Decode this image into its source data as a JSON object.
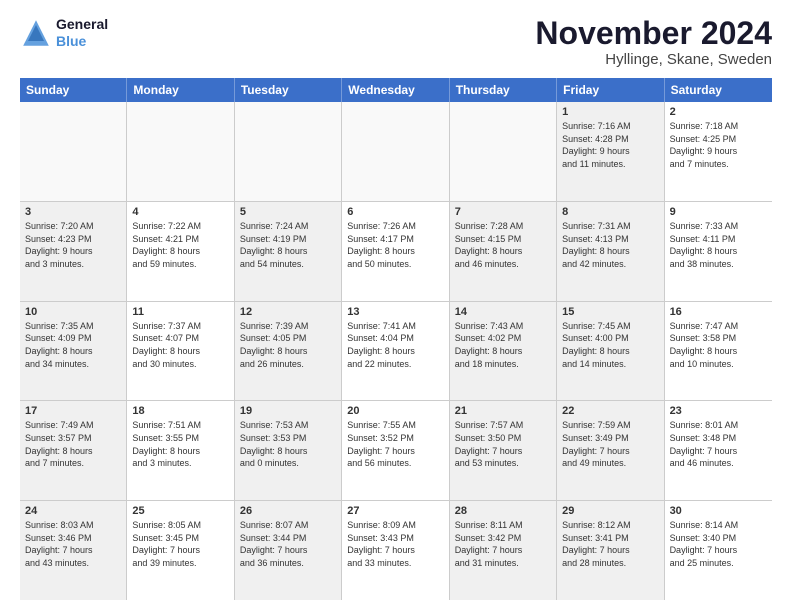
{
  "logo": {
    "line1": "General",
    "line2": "Blue"
  },
  "title": "November 2024",
  "subtitle": "Hyllinge, Skane, Sweden",
  "header_days": [
    "Sunday",
    "Monday",
    "Tuesday",
    "Wednesday",
    "Thursday",
    "Friday",
    "Saturday"
  ],
  "rows": [
    [
      {
        "day": "",
        "info": "",
        "empty": true
      },
      {
        "day": "",
        "info": "",
        "empty": true
      },
      {
        "day": "",
        "info": "",
        "empty": true
      },
      {
        "day": "",
        "info": "",
        "empty": true
      },
      {
        "day": "",
        "info": "",
        "empty": true
      },
      {
        "day": "1",
        "info": "Sunrise: 7:16 AM\nSunset: 4:28 PM\nDaylight: 9 hours\nand 11 minutes.",
        "shaded": true
      },
      {
        "day": "2",
        "info": "Sunrise: 7:18 AM\nSunset: 4:25 PM\nDaylight: 9 hours\nand 7 minutes."
      }
    ],
    [
      {
        "day": "3",
        "info": "Sunrise: 7:20 AM\nSunset: 4:23 PM\nDaylight: 9 hours\nand 3 minutes.",
        "shaded": true
      },
      {
        "day": "4",
        "info": "Sunrise: 7:22 AM\nSunset: 4:21 PM\nDaylight: 8 hours\nand 59 minutes."
      },
      {
        "day": "5",
        "info": "Sunrise: 7:24 AM\nSunset: 4:19 PM\nDaylight: 8 hours\nand 54 minutes.",
        "shaded": true
      },
      {
        "day": "6",
        "info": "Sunrise: 7:26 AM\nSunset: 4:17 PM\nDaylight: 8 hours\nand 50 minutes."
      },
      {
        "day": "7",
        "info": "Sunrise: 7:28 AM\nSunset: 4:15 PM\nDaylight: 8 hours\nand 46 minutes.",
        "shaded": true
      },
      {
        "day": "8",
        "info": "Sunrise: 7:31 AM\nSunset: 4:13 PM\nDaylight: 8 hours\nand 42 minutes.",
        "shaded": true
      },
      {
        "day": "9",
        "info": "Sunrise: 7:33 AM\nSunset: 4:11 PM\nDaylight: 8 hours\nand 38 minutes."
      }
    ],
    [
      {
        "day": "10",
        "info": "Sunrise: 7:35 AM\nSunset: 4:09 PM\nDaylight: 8 hours\nand 34 minutes.",
        "shaded": true
      },
      {
        "day": "11",
        "info": "Sunrise: 7:37 AM\nSunset: 4:07 PM\nDaylight: 8 hours\nand 30 minutes."
      },
      {
        "day": "12",
        "info": "Sunrise: 7:39 AM\nSunset: 4:05 PM\nDaylight: 8 hours\nand 26 minutes.",
        "shaded": true
      },
      {
        "day": "13",
        "info": "Sunrise: 7:41 AM\nSunset: 4:04 PM\nDaylight: 8 hours\nand 22 minutes."
      },
      {
        "day": "14",
        "info": "Sunrise: 7:43 AM\nSunset: 4:02 PM\nDaylight: 8 hours\nand 18 minutes.",
        "shaded": true
      },
      {
        "day": "15",
        "info": "Sunrise: 7:45 AM\nSunset: 4:00 PM\nDaylight: 8 hours\nand 14 minutes.",
        "shaded": true
      },
      {
        "day": "16",
        "info": "Sunrise: 7:47 AM\nSunset: 3:58 PM\nDaylight: 8 hours\nand 10 minutes."
      }
    ],
    [
      {
        "day": "17",
        "info": "Sunrise: 7:49 AM\nSunset: 3:57 PM\nDaylight: 8 hours\nand 7 minutes.",
        "shaded": true
      },
      {
        "day": "18",
        "info": "Sunrise: 7:51 AM\nSunset: 3:55 PM\nDaylight: 8 hours\nand 3 minutes."
      },
      {
        "day": "19",
        "info": "Sunrise: 7:53 AM\nSunset: 3:53 PM\nDaylight: 8 hours\nand 0 minutes.",
        "shaded": true
      },
      {
        "day": "20",
        "info": "Sunrise: 7:55 AM\nSunset: 3:52 PM\nDaylight: 7 hours\nand 56 minutes."
      },
      {
        "day": "21",
        "info": "Sunrise: 7:57 AM\nSunset: 3:50 PM\nDaylight: 7 hours\nand 53 minutes.",
        "shaded": true
      },
      {
        "day": "22",
        "info": "Sunrise: 7:59 AM\nSunset: 3:49 PM\nDaylight: 7 hours\nand 49 minutes.",
        "shaded": true
      },
      {
        "day": "23",
        "info": "Sunrise: 8:01 AM\nSunset: 3:48 PM\nDaylight: 7 hours\nand 46 minutes."
      }
    ],
    [
      {
        "day": "24",
        "info": "Sunrise: 8:03 AM\nSunset: 3:46 PM\nDaylight: 7 hours\nand 43 minutes.",
        "shaded": true
      },
      {
        "day": "25",
        "info": "Sunrise: 8:05 AM\nSunset: 3:45 PM\nDaylight: 7 hours\nand 39 minutes."
      },
      {
        "day": "26",
        "info": "Sunrise: 8:07 AM\nSunset: 3:44 PM\nDaylight: 7 hours\nand 36 minutes.",
        "shaded": true
      },
      {
        "day": "27",
        "info": "Sunrise: 8:09 AM\nSunset: 3:43 PM\nDaylight: 7 hours\nand 33 minutes."
      },
      {
        "day": "28",
        "info": "Sunrise: 8:11 AM\nSunset: 3:42 PM\nDaylight: 7 hours\nand 31 minutes.",
        "shaded": true
      },
      {
        "day": "29",
        "info": "Sunrise: 8:12 AM\nSunset: 3:41 PM\nDaylight: 7 hours\nand 28 minutes.",
        "shaded": true
      },
      {
        "day": "30",
        "info": "Sunrise: 8:14 AM\nSunset: 3:40 PM\nDaylight: 7 hours\nand 25 minutes."
      }
    ]
  ]
}
